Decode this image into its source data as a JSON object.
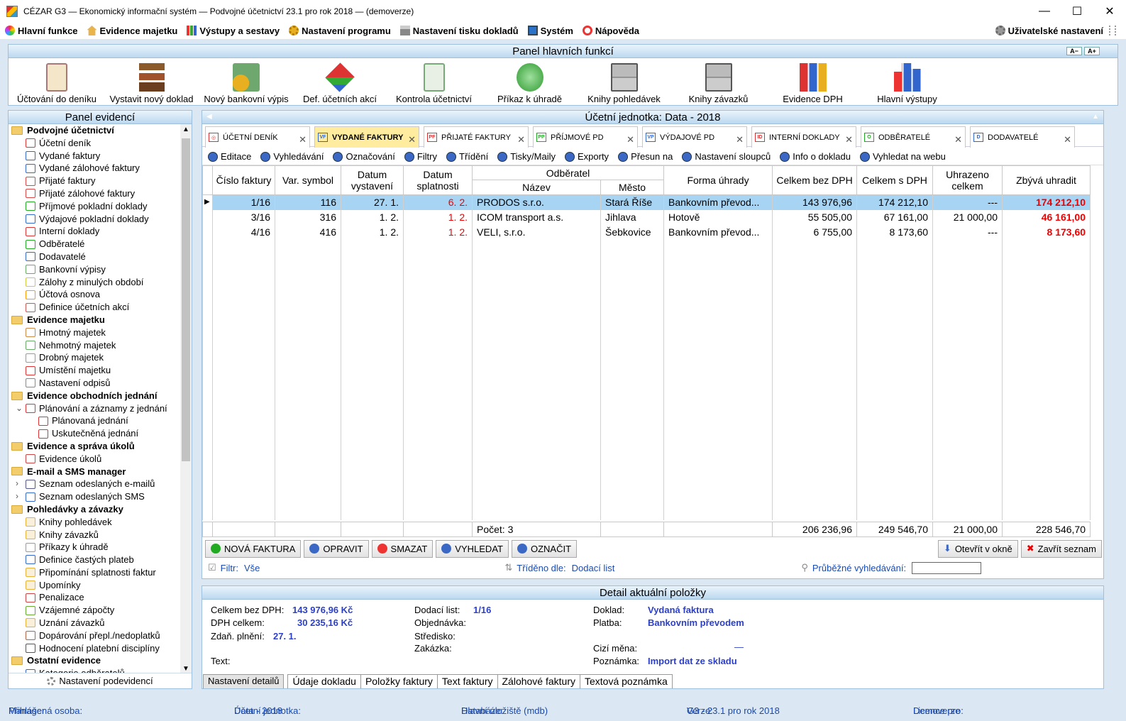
{
  "window": {
    "title": "CÉZAR G3 — Ekonomický informační systém — Podvojné účetnictví 23.1 pro rok 2018 — (demoverze)",
    "min": "—",
    "max": "☐",
    "close": "✕"
  },
  "menu": [
    "Hlavní funkce",
    "Evidence majetku",
    "Výstupy a sestavy",
    "Nastavení programu",
    "Nastavení tisku dokladů",
    "Systém",
    "Nápověda"
  ],
  "menu_right": "Uživatelské nastavení",
  "main_panel": {
    "title": "Panel hlavních funkcí",
    "a_minus": "A−",
    "a_plus": "A+",
    "functions": [
      "Účtování do deníku",
      "Vystavit nový doklad",
      "Nový bankovní výpis",
      "Def. účetních akcí",
      "Kontrola účetnictví",
      "Příkaz k úhradě",
      "Knihy pohledávek",
      "Knihy závazků",
      "Evidence DPH",
      "Hlavní výstupy"
    ]
  },
  "left_panel": {
    "title": "Panel evidencí",
    "footer": "Nastavení podevidencí",
    "tree": [
      {
        "t": "h",
        "l": "Podvojné účetnictví"
      },
      {
        "t": "i",
        "l": "Účetní deník",
        "ic": "#d33"
      },
      {
        "t": "i",
        "l": "Vydané faktury",
        "ic": "#36c"
      },
      {
        "t": "i",
        "l": "Vydané zálohové faktury",
        "ic": "#36c"
      },
      {
        "t": "i",
        "l": "Přijaté faktury",
        "ic": "#d44"
      },
      {
        "t": "i",
        "l": "Přijaté zálohové faktury",
        "ic": "#d44"
      },
      {
        "t": "i",
        "l": "Příjmové pokladní doklady",
        "ic": "#2a2"
      },
      {
        "t": "i",
        "l": "Výdajové pokladní doklady",
        "ic": "#36c"
      },
      {
        "t": "i",
        "l": "Interní doklady",
        "ic": "#d33"
      },
      {
        "t": "i",
        "l": "Odběratelé",
        "ic": "#2a2"
      },
      {
        "t": "i",
        "l": "Dodavatelé",
        "ic": "#36c"
      },
      {
        "t": "i",
        "l": "Bankovní výpisy",
        "ic": "#6a6"
      },
      {
        "t": "i",
        "l": "Zálohy z minulých období",
        "ic": "#cc4"
      },
      {
        "t": "i",
        "l": "Účtová osnova",
        "ic": "#f90"
      },
      {
        "t": "i",
        "l": "Definice účetních akcí",
        "ic": "#c55"
      },
      {
        "t": "h",
        "l": "Evidence majetku"
      },
      {
        "t": "i",
        "l": "Hmotný majetek",
        "ic": "#c84"
      },
      {
        "t": "i",
        "l": "Nehmotný majetek",
        "ic": "#6a6"
      },
      {
        "t": "i",
        "l": "Drobný majetek",
        "ic": "#999"
      },
      {
        "t": "i",
        "l": "Umístění majetku",
        "ic": "#d33"
      },
      {
        "t": "i",
        "l": "Nastavení odpisů",
        "ic": "#888"
      },
      {
        "t": "h",
        "l": "Evidence obchodních jednání"
      },
      {
        "t": "sub",
        "l": "Plánování a záznamy z jednání",
        "ic": "#d33",
        "arrow": "⌄"
      },
      {
        "t": "i2",
        "l": "Plánovaná jednání",
        "ic": "#d33"
      },
      {
        "t": "i2",
        "l": "Uskutečněná jednání",
        "ic": "#d33"
      },
      {
        "t": "h",
        "l": "Evidence a správa úkolů"
      },
      {
        "t": "i",
        "l": "Evidence úkolů",
        "ic": "#c44"
      },
      {
        "t": "h",
        "l": "E-mail a SMS manager"
      },
      {
        "t": "sub",
        "l": "Seznam odeslaných e-mailů",
        "ic": "#558",
        "arrow": "›"
      },
      {
        "t": "sub",
        "l": "Seznam odeslaných SMS",
        "ic": "#36c",
        "arrow": "›"
      },
      {
        "t": "h",
        "l": "Pohledávky a závazky"
      },
      {
        "t": "i",
        "l": "Knihy pohledávek",
        "ic": "#e8b13a"
      },
      {
        "t": "i",
        "l": "Knihy závazků",
        "ic": "#e8b13a"
      },
      {
        "t": "i",
        "l": "Příkazy k úhradě",
        "ic": "#999"
      },
      {
        "t": "i",
        "l": "Definice častých plateb",
        "ic": "#36c"
      },
      {
        "t": "i",
        "l": "Připomínání splatnosti faktur",
        "ic": "#e8b13a"
      },
      {
        "t": "i",
        "l": "Upomínky",
        "ic": "#e8b13a"
      },
      {
        "t": "i",
        "l": "Penalizace",
        "ic": "#c44"
      },
      {
        "t": "i",
        "l": "Vzájemné zápočty",
        "ic": "#6a3"
      },
      {
        "t": "i",
        "l": "Uznání závazků",
        "ic": "#e8b13a"
      },
      {
        "t": "i",
        "l": "Dopárování přepl./nedoplatků",
        "ic": "#a64"
      },
      {
        "t": "i",
        "l": "Hodnocení platební disciplíny",
        "ic": "#555"
      },
      {
        "t": "h",
        "l": "Ostatní evidence"
      },
      {
        "t": "i",
        "l": "Kategorie odběratelů",
        "ic": "#36c"
      }
    ]
  },
  "center": {
    "title": "Účetní jednotka: Data - 2018",
    "tabs": [
      {
        "label": "ÚČETNÍ DENÍK",
        "ic": "◎",
        "c": "#d33"
      },
      {
        "label": "VYDANÉ FAKTURY",
        "ic": "VF",
        "c": "#36c"
      },
      {
        "label": "PŘIJATÉ FAKTURY",
        "ic": "PF",
        "c": "#d33"
      },
      {
        "label": "PŘÍJMOVÉ PD",
        "ic": "PP",
        "c": "#2a2"
      },
      {
        "label": "VÝDAJOVÉ PD",
        "ic": "VP",
        "c": "#36c"
      },
      {
        "label": "INTERNÍ DOKLADY",
        "ic": "ID",
        "c": "#d33"
      },
      {
        "label": "ODBĚRATELÉ",
        "ic": "O",
        "c": "#2a2"
      },
      {
        "label": "DODAVATELÉ",
        "ic": "D",
        "c": "#36c"
      }
    ],
    "toolbar": [
      "Editace",
      "Vyhledávání",
      "Označování",
      "Filtry",
      "Třídění",
      "Tisky/Maily",
      "Exporty",
      "Přesun na",
      "Nastavení sloupců",
      "Info o dokladu",
      "Vyhledat na webu"
    ],
    "columns": {
      "cislo": "Číslo faktury",
      "var": "Var. symbol",
      "vyst": "Datum vystavení",
      "spl": "Datum splatnosti",
      "odb": "Odběratel",
      "nazev": "Název",
      "mesto": "Město",
      "forma": "Forma úhrady",
      "bez": "Celkem bez DPH",
      "sdph": "Celkem s DPH",
      "uhr": "Uhrazeno celkem",
      "zbyva": "Zbývá uhradit"
    },
    "rows": [
      {
        "cislo": "1/16",
        "var": "116",
        "vyst": "27. 1.",
        "spl": "6. 2.",
        "nazev": "PRODOS s.r.o.",
        "mesto": "Stará Říše",
        "forma": "Bankovním převod...",
        "bez": "143 976,96",
        "sdph": "174 212,10",
        "uhr": "---",
        "zbyva": "174 212,10"
      },
      {
        "cislo": "3/16",
        "var": "316",
        "vyst": "1. 2.",
        "spl": "1. 2.",
        "nazev": "ICOM transport a.s.",
        "mesto": "Jihlava",
        "forma": "Hotově",
        "bez": "55 505,00",
        "sdph": "67 161,00",
        "uhr": "21 000,00",
        "zbyva": "46 161,00"
      },
      {
        "cislo": "4/16",
        "var": "416",
        "vyst": "1. 2.",
        "spl": "1. 2.",
        "nazev": "VELI, s.r.o.",
        "mesto": "Šebkovice",
        "forma": "Bankovním převod...",
        "bez": "6 755,00",
        "sdph": "8 173,60",
        "uhr": "---",
        "zbyva": "8 173,60"
      }
    ],
    "sum": {
      "pocet": "Počet: 3",
      "bez": "206 236,96",
      "sdph": "249 546,70",
      "uhr": "21 000,00",
      "zbyva": "228 546,70"
    },
    "buttons": {
      "nova": "NOVÁ FAKTURA",
      "opravit": "OPRAVIT",
      "smazat": "SMAZAT",
      "vyhledat": "VYHLEDAT",
      "oznacit": "OZNAČIT",
      "otevrit": "Otevřít v okně",
      "zavrit": "Zavřít seznam"
    },
    "filter": {
      "label": "Filtr:",
      "value": "Vše",
      "sort_label": "Tříděno dle:",
      "sort_value": "Dodací list",
      "search_label": "Průběžné vyhledávání:",
      "search_value": ""
    }
  },
  "detail": {
    "title": "Detail aktuální položky",
    "l1": "Celkem bez DPH:",
    "v1": "143 976,96 Kč",
    "l2": "DPH celkem:",
    "v2": "30 235,16 Kč",
    "l3": "Zdaň. plnění:",
    "v3": "27. 1.",
    "l4": "Text:",
    "l5": "Dodací list:",
    "v5": "1/16",
    "l6": "Objednávka:",
    "l7": "Středisko:",
    "l8": "Zakázka:",
    "l9": "Doklad:",
    "v9": "Vydaná faktura",
    "l10": "Platba:",
    "v10": "Bankovním převodem",
    "l11": "Cizí měna:",
    "v11": "—",
    "l12": "Poznámka:",
    "v12": "Import dat ze skladu",
    "tabs": [
      "Nastavení detailů",
      "Údaje dokladu",
      "Položky faktury",
      "Text faktury",
      "Zálohové faktury",
      "Textová poznámka"
    ]
  },
  "status": {
    "osoba_l": "Přihlášená osoba:",
    "osoba": "Manager",
    "jed_l": "Účetní jednotka:",
    "jed": "Data - 2018",
    "db_l": "Databáze:",
    "db": "Hlavní úložiště  (mdb)",
    "ver_l": "Verze:",
    "ver": "G3 - 23.1 pro rok 2018",
    "lic_l": "Licence pro:",
    "lic": "Demoverze"
  }
}
